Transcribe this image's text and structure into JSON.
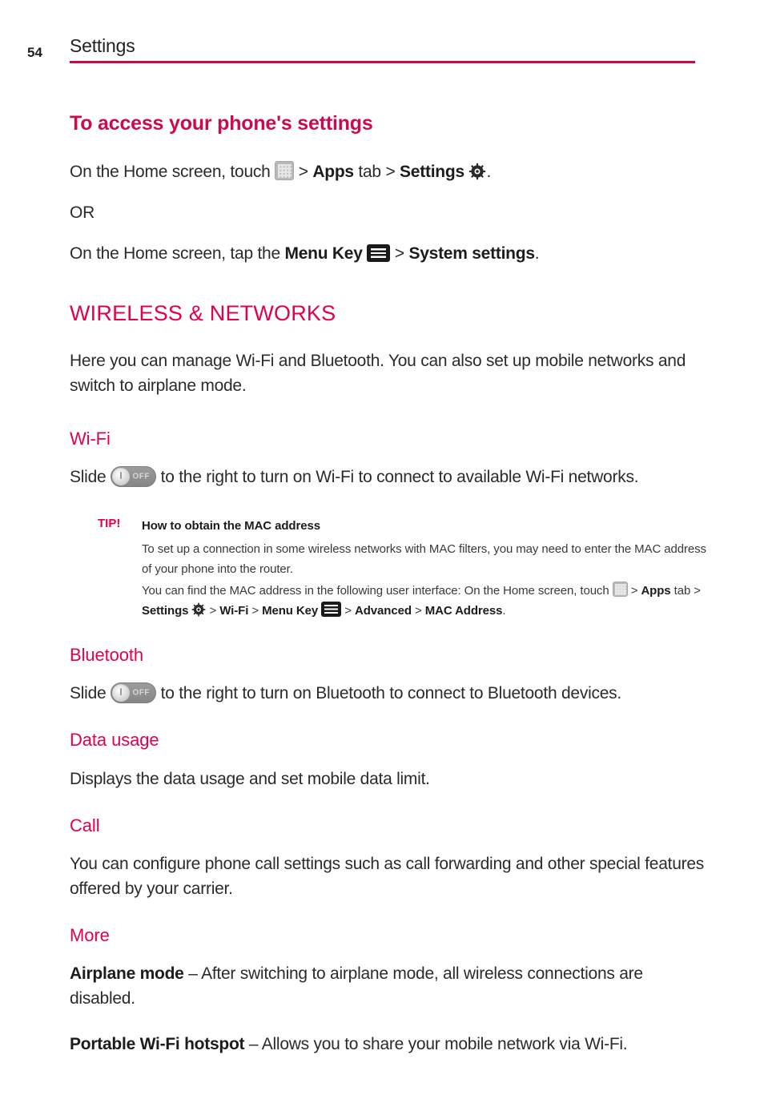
{
  "header": {
    "page_number": "54",
    "title": "Settings",
    "rule_color": "#c5094c"
  },
  "colors": {
    "accent_magenta": "#e3004f",
    "heading_magenta": "#cc0a4f",
    "body_text": "#2b2b2b"
  },
  "sections": {
    "access": {
      "heading": "To access your phone's settings",
      "line1_a": "On the Home screen, touch ",
      "line1_b": " > ",
      "line1_apps": "Apps",
      "line1_c": " tab > ",
      "line1_settings": "Settings",
      "line1_d": ".",
      "or": "OR",
      "line2_a": "On the Home screen, tap the ",
      "line2_menukey": "Menu Key",
      "line2_b": " > ",
      "line2_system": "System settings",
      "line2_c": "."
    },
    "wireless": {
      "heading": "WIRELESS & NETWORKS",
      "body": "Here you can manage Wi-Fi and Bluetooth. You can also set up mobile networks and switch to airplane mode."
    },
    "wifi": {
      "heading": "Wi-Fi",
      "body_a": "Slide ",
      "body_b": " to the right to turn on Wi-Fi to connect to available Wi-Fi networks.",
      "toggle_state_label": "OFF"
    },
    "tip": {
      "label": "TIP!",
      "title": "How to obtain the MAC address",
      "para1": "To set up a connection in some wireless networks with MAC filters, you may need to enter the MAC address of your phone into the router.",
      "para2_a": "You can find the MAC address in the following user interface: On the Home screen, touch ",
      "para2_b": " > ",
      "para2_apps": "Apps",
      "para2_c": " tab > ",
      "para2_settings": "Settings",
      "para2_d": " > ",
      "para2_wifi": "Wi-Fi",
      "para2_e": " > ",
      "para2_menukey": "Menu Key",
      "para2_f": " > ",
      "para2_advanced": "Advanced",
      "para2_g": " > ",
      "para2_mac": "MAC Address",
      "para2_h": "."
    },
    "bluetooth": {
      "heading": "Bluetooth",
      "body_a": "Slide ",
      "body_b": " to the right to turn on Bluetooth to connect to Bluetooth devices.",
      "toggle_state_label": "OFF"
    },
    "data_usage": {
      "heading": "Data usage",
      "body": "Displays the data usage and set mobile data limit."
    },
    "call": {
      "heading": "Call",
      "body": "You can configure phone call settings such as call forwarding and other special features offered by your carrier."
    },
    "more": {
      "heading": "More",
      "airplane_term": "Airplane mode",
      "airplane_desc": " – After switching to airplane mode, all wireless connections are disabled.",
      "hotspot_term": "Portable Wi-Fi hotspot",
      "hotspot_desc": " – Allows you to share your mobile network via Wi-Fi."
    }
  },
  "icons": {
    "apps": "apps-grid-icon",
    "settings": "gear-icon",
    "menu_key": "hamburger-menu-icon",
    "toggle": "toggle-switch-off-icon"
  }
}
